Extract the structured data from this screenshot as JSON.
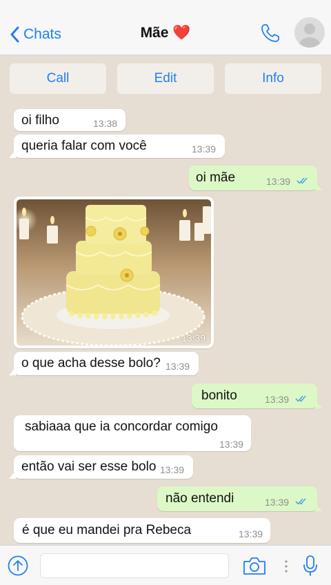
{
  "header": {
    "back_label": "Chats",
    "title": "Mãe",
    "title_emoji": "❤️",
    "icons": [
      "chevron-left-icon",
      "phone-icon",
      "avatar-icon"
    ]
  },
  "actions": {
    "call": "Call",
    "edit": "Edit",
    "info": "Info"
  },
  "colors": {
    "accent": "#1f7ef3",
    "outgoing_bubble": "#dcf8c6",
    "incoming_bubble": "#ffffff",
    "chat_background": "#e6ddd3",
    "read_ticks": "#4fa3e6"
  },
  "messages": [
    {
      "dir": "in",
      "text": "oi filho",
      "time": "13:38"
    },
    {
      "dir": "in",
      "text": "queria falar com você",
      "time": "13:39"
    },
    {
      "dir": "out",
      "text": "oi mãe",
      "time": "13:39",
      "read": true
    },
    {
      "dir": "in",
      "type": "image",
      "image": "yellow tiered cake photo",
      "time": "13:39"
    },
    {
      "dir": "in",
      "text": "o que acha desse bolo?",
      "time": "13:39"
    },
    {
      "dir": "out",
      "text": "bonito",
      "time": "13:39",
      "read": true
    },
    {
      "dir": "in",
      "text": "sabiaaa que ia concordar comigo",
      "time": "13:39"
    },
    {
      "dir": "in",
      "text": "então vai ser esse bolo",
      "time": "13:39"
    },
    {
      "dir": "out",
      "text": "não entendi",
      "time": "13:39",
      "read": true
    },
    {
      "dir": "in",
      "text": "é que eu mandei pra Rebeca",
      "time": "13:39"
    }
  ],
  "composer": {
    "placeholder": "",
    "icons": [
      "upload-icon",
      "camera-icon",
      "more-icon",
      "microphone-icon"
    ]
  }
}
